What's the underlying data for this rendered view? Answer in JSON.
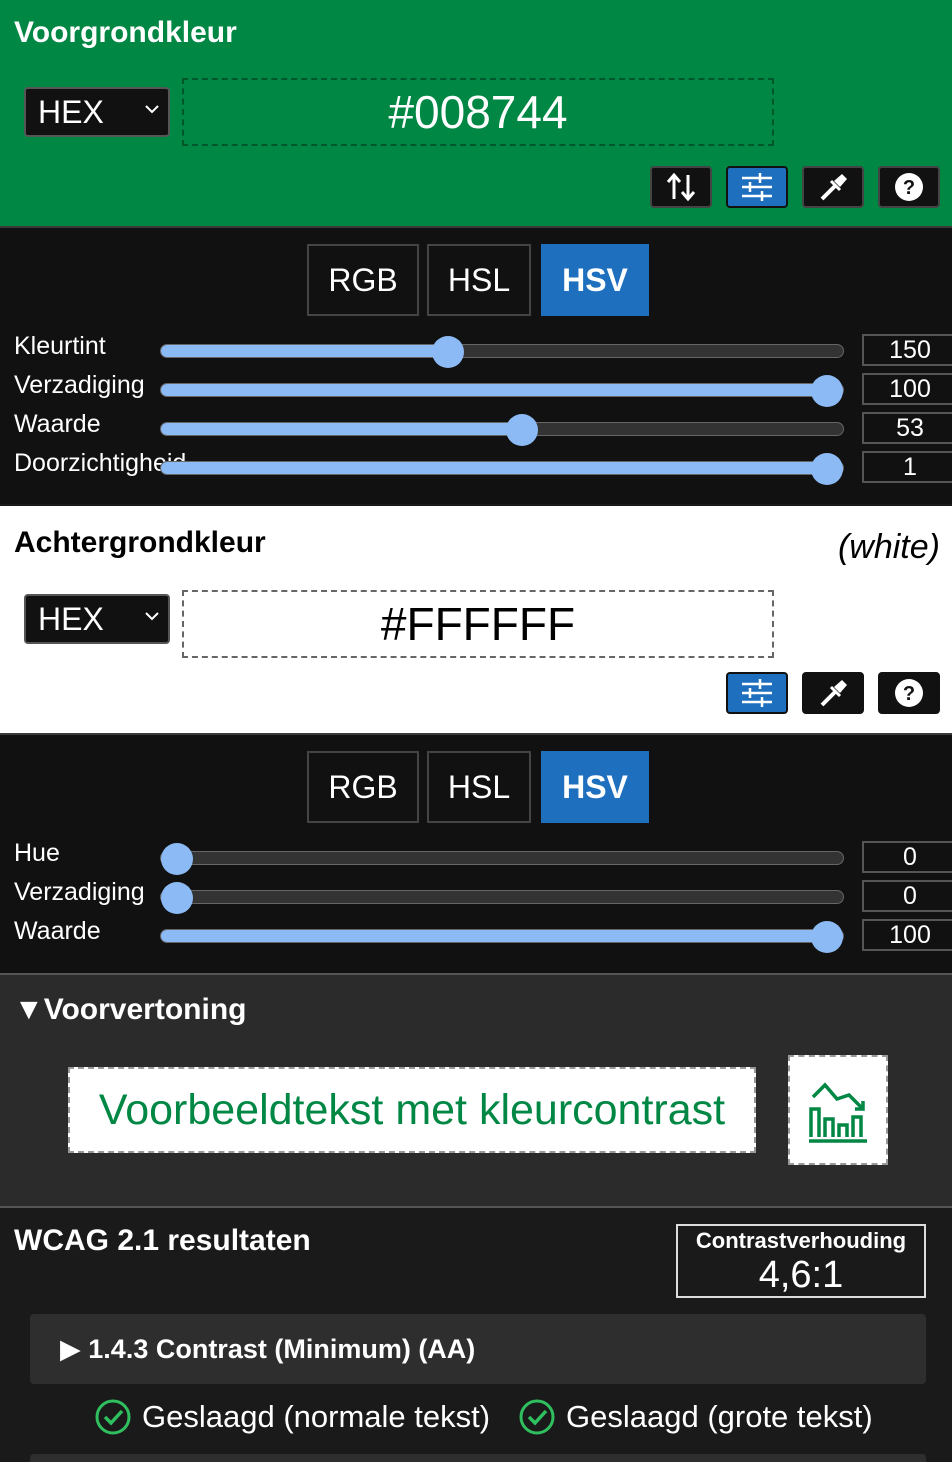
{
  "foreground": {
    "title": "Voorgrondkleur",
    "format": "HEX",
    "hex": "#008744",
    "color": "#008744"
  },
  "fg_model": {
    "tabs": [
      "RGB",
      "HSL",
      "HSV"
    ],
    "active_tab": "HSV",
    "sliders": [
      {
        "label": "Kleurtint",
        "value": "150",
        "fraction": 0.4167
      },
      {
        "label": "Verzadiging",
        "value": "100",
        "fraction": 1.0
      },
      {
        "label": "Waarde",
        "value": "53",
        "fraction": 0.53
      },
      {
        "label": "Doorzichtigheid",
        "value": "1",
        "fraction": 1.0
      }
    ]
  },
  "background": {
    "title": "Achtergrondkleur",
    "named": "(white)",
    "format": "HEX",
    "hex": "#FFFFFF",
    "color": "#FFFFFF"
  },
  "bg_model": {
    "tabs": [
      "RGB",
      "HSL",
      "HSV"
    ],
    "active_tab": "HSV",
    "sliders": [
      {
        "label": "Hue",
        "value": "0",
        "fraction": 0.0
      },
      {
        "label": "Verzadiging",
        "value": "0",
        "fraction": 0.0
      },
      {
        "label": "Waarde",
        "value": "100",
        "fraction": 1.0
      }
    ]
  },
  "preview": {
    "title": "Voorvertoning",
    "sample_text": "Voorbeeldtekst met kleurcontrast"
  },
  "wcag": {
    "title": "WCAG 2.1 resultaten",
    "ratio_label": "Contrastverhouding",
    "ratio_value": "4,6:1",
    "criterion": "1.4.3 Contrast (Minimum) (AA)",
    "result_normal": "Geslaagd (normale tekst)",
    "result_large": "Geslaagd (grote tekst)"
  },
  "colors": {
    "accent": "#1f6fbf",
    "slider": "#8cbaf4",
    "pass": "#2fbf5f"
  }
}
